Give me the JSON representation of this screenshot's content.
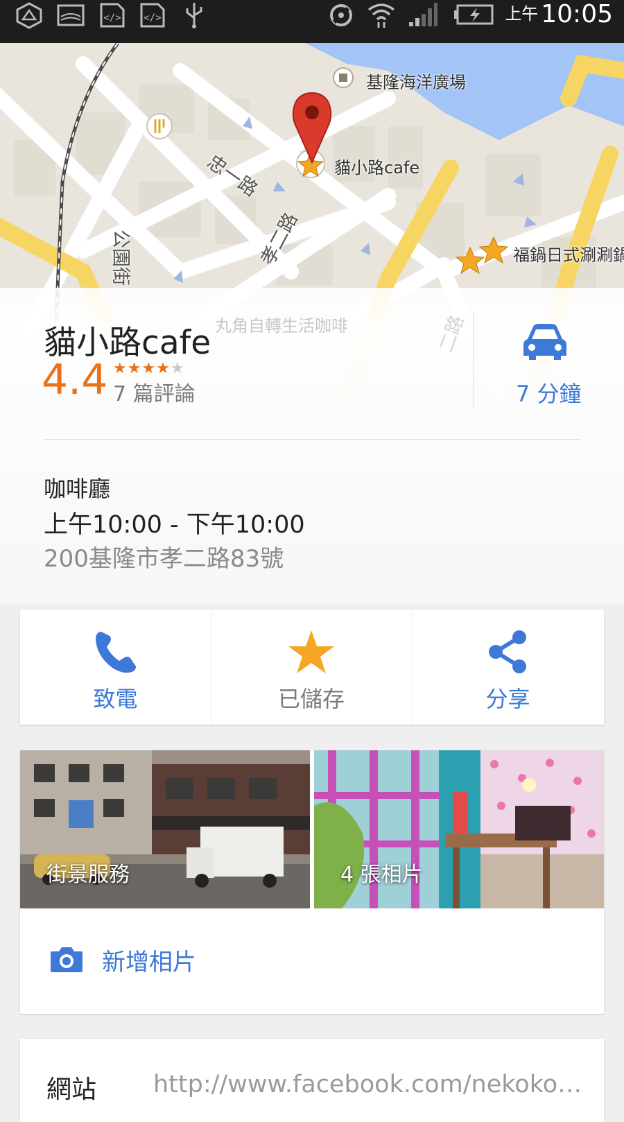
{
  "status_bar": {
    "time_prefix": "上午",
    "time": "10:05",
    "icons": [
      "ingress-icon",
      "gallery-icon",
      "code-icon",
      "code-icon",
      "usb-icon",
      "gps-icon",
      "wifi-icon",
      "signal-icon",
      "battery-charging-icon"
    ]
  },
  "map": {
    "pois": {
      "plaza": "基隆海洋廣場",
      "cafe": "貓小路cafe",
      "hotpot": "福鍋日式涮涮鍋",
      "bike_cafe": "丸角自轉生活咖啡"
    },
    "roads": {
      "zhongyi": "忠一路",
      "xiaoer": "孝二路",
      "gongyuan": "公園街",
      "other": "二路"
    }
  },
  "place": {
    "name": "貓小路cafe",
    "rating": "4.4",
    "stars": "★★★★",
    "star_last": "★",
    "reviews": "7 篇評論",
    "drive_time": "7 分鐘",
    "category": "咖啡廳",
    "hours": "上午10:00 - 下午10:00",
    "address": "200基隆市孝二路83號"
  },
  "actions": {
    "call": "致電",
    "saved": "已儲存",
    "share": "分享"
  },
  "photos": {
    "street_view": "街景服務",
    "photo_count": "4 張相片",
    "add_photo": "新增相片"
  },
  "website": {
    "label": "網站",
    "value": "http://www.facebook.com/nekokoji..."
  },
  "colors": {
    "accent_blue": "#3c79d8",
    "rating_orange": "#e8711a",
    "saved_star": "#f5a623",
    "pin_red": "#d93a2b"
  }
}
